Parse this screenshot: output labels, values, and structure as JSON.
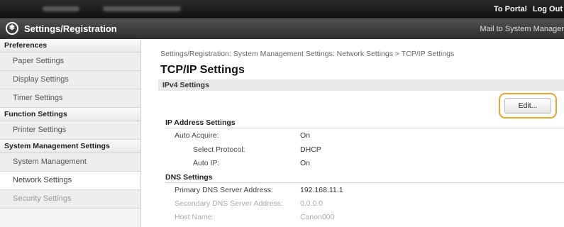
{
  "header": {
    "links": [
      "To Portal",
      "Log Out"
    ],
    "app_title": "Settings/Registration",
    "mail_link": "Mail to System Manager"
  },
  "sidebar": {
    "groups": [
      {
        "label": "Preferences",
        "items": [
          "Paper Settings",
          "Display Settings",
          "Timer Settings"
        ]
      },
      {
        "label": "Function Settings",
        "items": [
          "Printer Settings"
        ]
      },
      {
        "label": "System Management Settings",
        "items": [
          "System Management",
          "Network Settings",
          "Security Settings"
        ]
      }
    ],
    "active_item": "Network Settings"
  },
  "main": {
    "breadcrumb": "Settings/Registration: System Management Settings: Network Settings > TCP/IP Settings",
    "title": "TCP/IP Settings",
    "section": "IPv4 Settings",
    "edit_button": "Edit...",
    "ip_group": {
      "title": "IP Address Settings",
      "rows": [
        {
          "label": "Auto Acquire:",
          "value": "On"
        },
        {
          "label": "Select Protocol:",
          "value": "DHCP"
        },
        {
          "label": "Auto IP:",
          "value": "On"
        }
      ]
    },
    "dns_group": {
      "title": "DNS Settings",
      "rows": [
        {
          "label": "Primary DNS Server Address:",
          "value": "192.168.11.1"
        },
        {
          "label": "Secondary DNS Server Address:",
          "value": "0.0.0.0"
        },
        {
          "label": "Host Name:",
          "value": "Canon000"
        }
      ]
    }
  },
  "colors": {
    "highlight": "#f0a328",
    "topbar": "#1a1a1a",
    "titlebar": "#3c3c3c"
  }
}
